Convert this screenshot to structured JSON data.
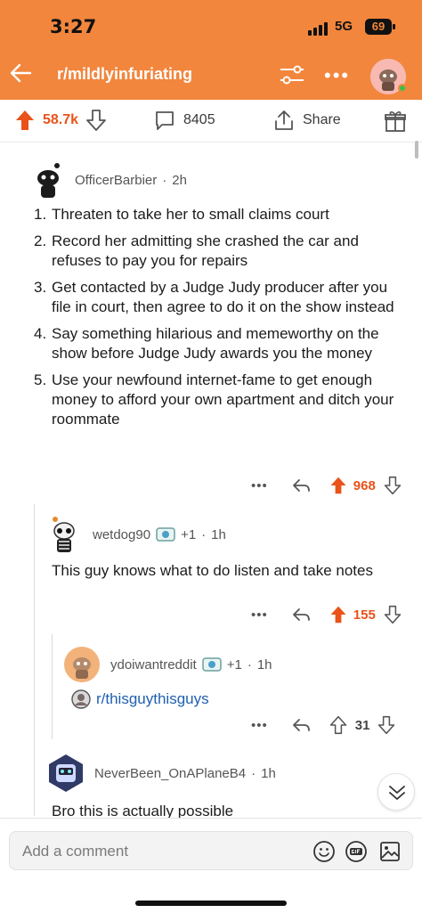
{
  "status": {
    "time": "3:27",
    "network": "5G",
    "battery": "69"
  },
  "header": {
    "subreddit": "r/mildlyinfuriating"
  },
  "post_actions": {
    "score": "58.7k",
    "comments": "8405",
    "share": "Share"
  },
  "comments": [
    {
      "author": "OfficerBarbier",
      "age": "2h",
      "items": [
        "Threaten to take her to small claims court",
        "Record her admitting she crashed the car and refuses to pay you for repairs",
        "Get contacted by a Judge Judy producer after you file in court, then agree to do it on the show instead",
        "Say something hilarious and memeworthy on the show before Judge Judy awards you the money",
        "Use your newfound internet-fame to get enough money to afford your own apartment and ditch your roommate"
      ],
      "numbers": [
        "1.",
        "2.",
        "3.",
        "4.",
        "5."
      ],
      "score": "968"
    },
    {
      "author": "wetdog90",
      "extra": "+1",
      "age": "1h",
      "body": "This guy knows what to do listen and take notes",
      "score": "155"
    },
    {
      "author": "ydoiwantreddit",
      "extra": "+1",
      "age": "1h",
      "link": "r/thisguythisguys",
      "score": "31"
    },
    {
      "author": "NeverBeen_OnAPlaneB4",
      "age": "1h",
      "body": "Bro this is actually possible"
    }
  ],
  "composer": {
    "placeholder": "Add a comment"
  },
  "colors": {
    "header": "#f2863d",
    "upvote": "#e9531a",
    "link": "#1f5fb2"
  }
}
